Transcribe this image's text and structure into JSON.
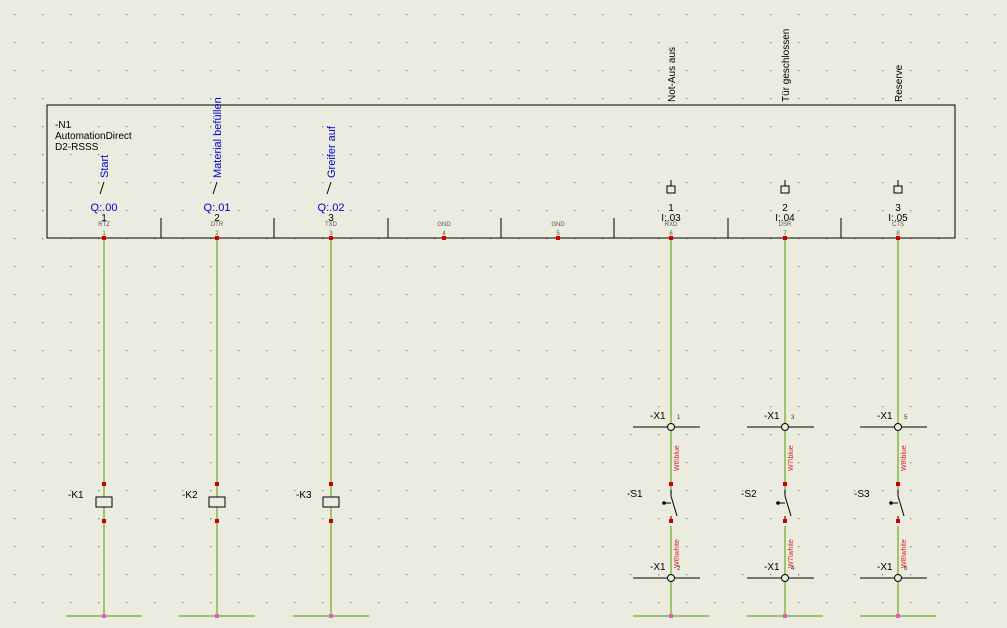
{
  "device": {
    "tag": "-N1",
    "manufacturer": "AutomationDirect",
    "model": "D2-RSSS"
  },
  "outputs": [
    {
      "comment": "Start",
      "address": "Q:.00",
      "num": "1",
      "pin_label": "RTZ",
      "pin": "1",
      "relay": "-K1"
    },
    {
      "comment": "Material befüllen",
      "address": "Q:.01",
      "num": "2",
      "pin_label": "DTR",
      "pin": "2",
      "relay": "-K2"
    },
    {
      "comment": "Greifer auf",
      "address": "Q:.02",
      "num": "3",
      "pin_label": "TXD",
      "pin": "3",
      "relay": "-K3"
    }
  ],
  "gnd": [
    {
      "pin_label": "GND",
      "pin": "4"
    },
    {
      "pin_label": "GND",
      "pin": "5"
    }
  ],
  "inputs": [
    {
      "comment": "Not-Aus aus",
      "num": "1",
      "address": "I:.03",
      "pin_label": "RXD",
      "pin": "6",
      "terminal": "-X1",
      "term_top": "1",
      "term_bot": "2",
      "switch": "-S1",
      "wire_top": "W6\\blue",
      "wire_bot": "W6\\white"
    },
    {
      "comment": "Tür geschlossen",
      "num": "2",
      "address": "I:.04",
      "pin_label": "DSR",
      "pin": "7",
      "terminal": "-X1",
      "term_top": "3",
      "term_bot": "4",
      "switch": "-S2",
      "wire_top": "W7\\blue",
      "wire_bot": "W7\\white"
    },
    {
      "comment": "Reserve",
      "num": "3",
      "address": "I:.05",
      "pin_label": "CTS",
      "pin": "8",
      "terminal": "-X1",
      "term_top": "5",
      "term_bot": "6",
      "switch": "-S3",
      "wire_top": "W8\\blue",
      "wire_bot": "W8\\white"
    }
  ],
  "colors": {
    "background": "#ecebe0",
    "wire": "#6aaa2a",
    "address_text": "#0000cc",
    "wire_label": "#dd2222",
    "connection_dot": "#cc0000",
    "bus_end_dot": "#e060c0"
  }
}
